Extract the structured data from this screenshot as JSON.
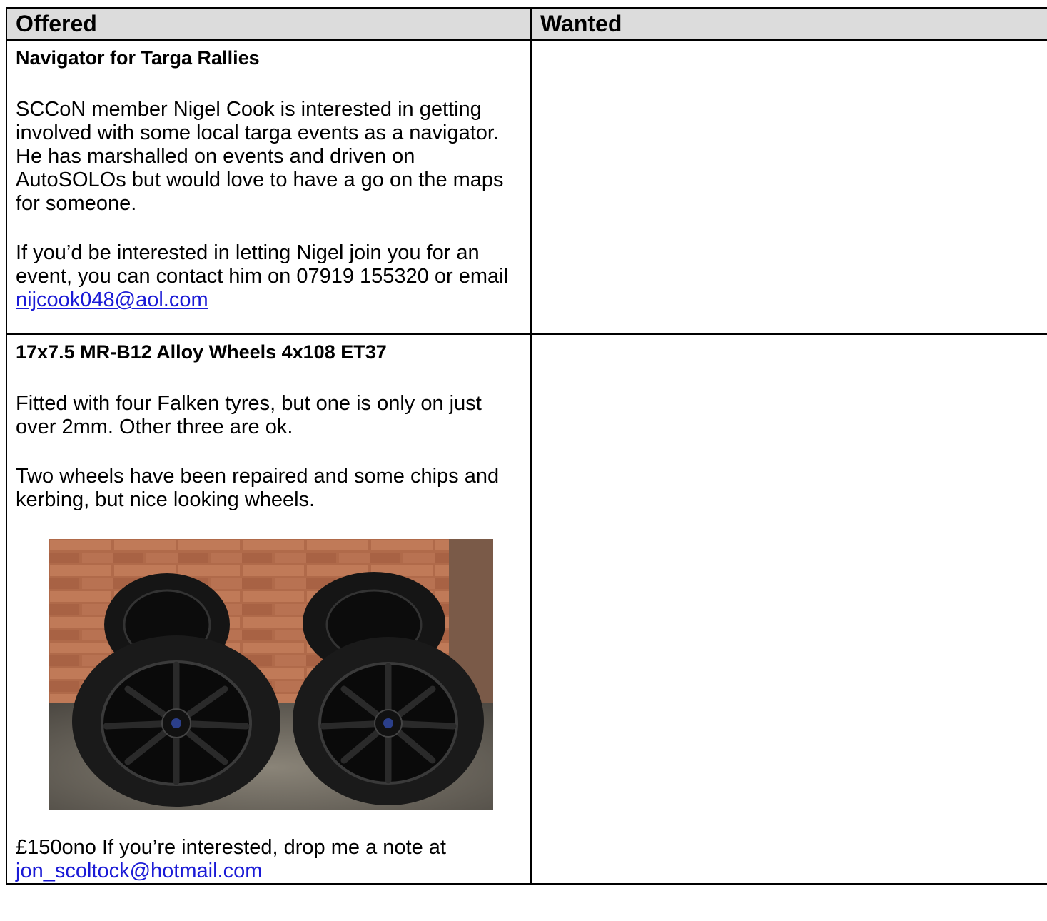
{
  "table": {
    "headers": {
      "offered": "Offered",
      "wanted": "Wanted"
    },
    "rows": [
      {
        "offered": {
          "title": "Navigator for Targa Rallies",
          "paragraphs": [
            "SCCoN member Nigel Cook is interested in getting involved with some local targa events as a navigator. He has marshalled on events and driven on AutoSOLOs but would love to have a go on the maps for someone."
          ],
          "contact_text": "If you’d be interested in letting Nigel join you for an event, you can contact him on 07919 155320 or email ",
          "email": "nijcook048@aol.com"
        },
        "wanted": ""
      },
      {
        "offered": {
          "title": "17x7.5 MR-B12 Alloy Wheels 4x108 ET37",
          "paragraphs": [
            "Fitted with four Falken tyres, but one is only on just over 2mm. Other three are ok.",
            "Two wheels have been repaired and some chips and kerbing, but nice looking wheels."
          ],
          "photo": "alloy-wheels-photo",
          "contact_text": "£150ono If you’re interested, drop me a note at ",
          "email": "jon_scoltock@hotmail.com"
        },
        "wanted": ""
      }
    ]
  },
  "colors": {
    "header_bg": "#dcdcdc",
    "border": "#000000",
    "link": "#1a1ad6",
    "brick": "#b06a4a",
    "floor": "#6e6a62",
    "tyre": "#151515"
  }
}
